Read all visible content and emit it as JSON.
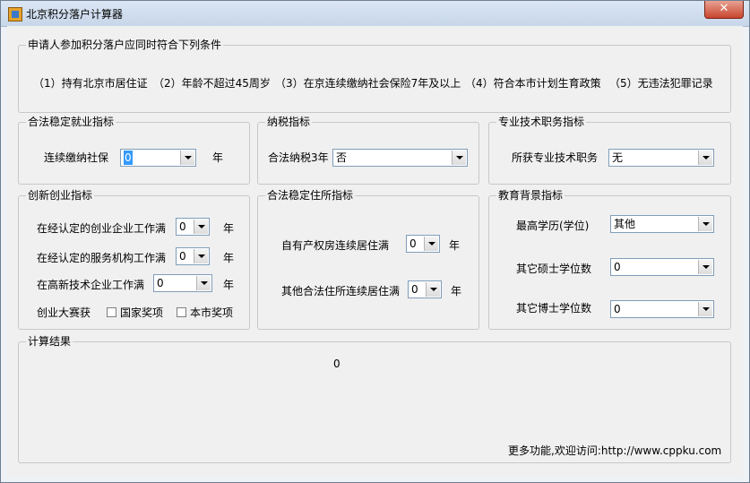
{
  "window": {
    "title": "北京积分落户计算器",
    "close_label": "✕"
  },
  "conditions": {
    "title": "申请人参加积分落户应同时符合下列条件",
    "items": [
      "（1）持有北京市居住证",
      "（2）年龄不超过45周岁",
      "（3）在京连续缴纳社会保险7年及以上",
      "（4）符合本市计划生育政策",
      "（5）无违法犯罪记录"
    ]
  },
  "employment": {
    "title": "合法稳定就业指标",
    "social_label": "连续缴纳社保",
    "social_value": "0",
    "unit": "年"
  },
  "tax": {
    "title": "纳税指标",
    "label": "合法纳税3年",
    "value": "否"
  },
  "professional": {
    "title": "专业技术职务指标",
    "label": "所获专业技术职务",
    "value": "无"
  },
  "startup": {
    "title": "创新创业指标",
    "rows": [
      {
        "label": "在经认定的创业企业工作满",
        "value": "0",
        "unit": "年"
      },
      {
        "label": "在经认定的服务机构工作满",
        "value": "0",
        "unit": "年"
      },
      {
        "label": "在高新技术企业工作满",
        "value": "0",
        "unit": "年"
      }
    ],
    "contest_label": "创业大赛获",
    "national_label": "国家奖项",
    "city_label": "本市奖项"
  },
  "residence": {
    "title": "合法稳定住所指标",
    "owned_label": "自有产权房连续居住满",
    "owned_value": "0",
    "other_label": "其他合法住所连续居住满",
    "other_value": "0",
    "unit": "年"
  },
  "education": {
    "title": "教育背景指标",
    "degree_label": "最高学历(学位)",
    "degree_value": "其他",
    "masters_label": "其它硕士学位数",
    "masters_value": "0",
    "phd_label": "其它博士学位数",
    "phd_value": "0"
  },
  "result": {
    "title": "计算结果",
    "value": "0",
    "footer": "更多功能,欢迎访问:http://www.cppku.com"
  }
}
